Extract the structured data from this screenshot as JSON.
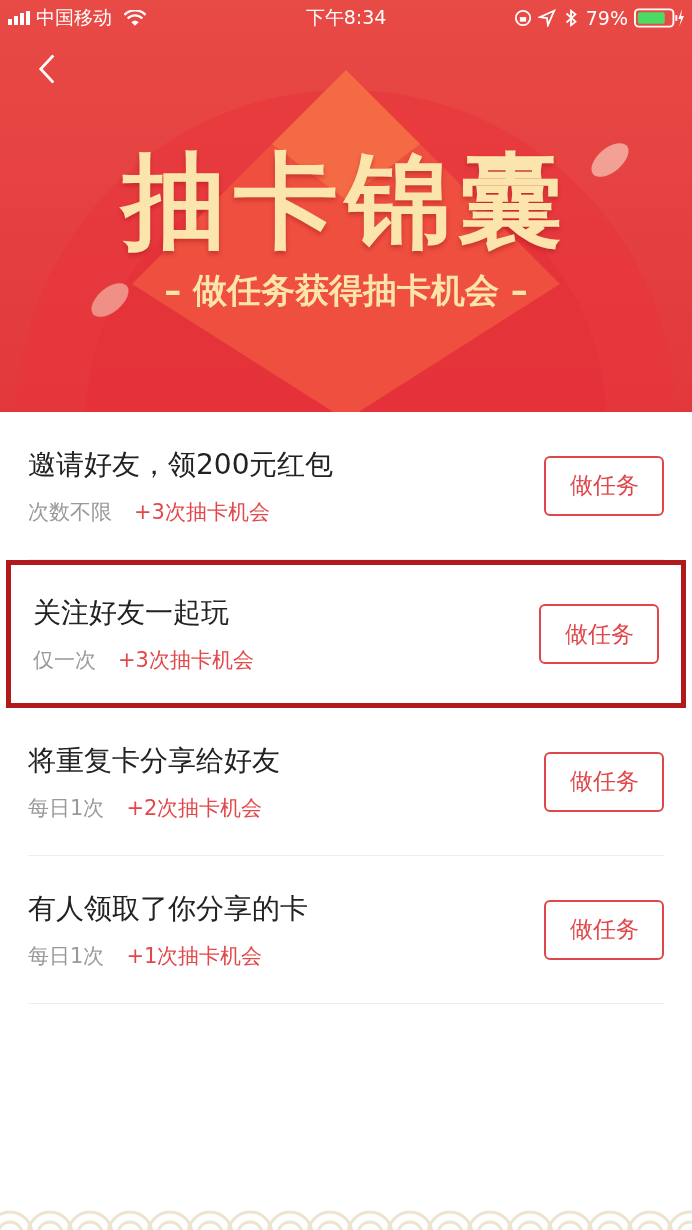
{
  "status_bar": {
    "carrier": "中国移动",
    "time": "下午8:34",
    "battery": "79%"
  },
  "banner": {
    "title": "抽卡锦囊",
    "subtitle": "– 做任务获得抽卡机会 –"
  },
  "tasks": [
    {
      "title": "邀请好友，领200元红包",
      "limit": "次数不限",
      "reward": "+3次抽卡机会",
      "button": "做任务",
      "highlighted": false
    },
    {
      "title": "关注好友一起玩",
      "limit": "仅一次",
      "reward": "+3次抽卡机会",
      "button": "做任务",
      "highlighted": true
    },
    {
      "title": "将重复卡分享给好友",
      "limit": "每日1次",
      "reward": "+2次抽卡机会",
      "button": "做任务",
      "highlighted": false
    },
    {
      "title": "有人领取了你分享的卡",
      "limit": "每日1次",
      "reward": "+1次抽卡机会",
      "button": "做任务",
      "highlighted": false
    }
  ]
}
